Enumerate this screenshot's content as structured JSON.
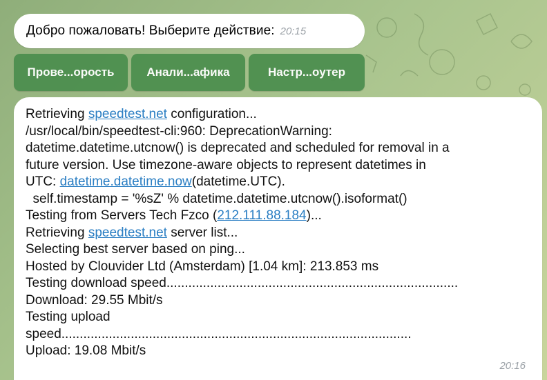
{
  "chat": {
    "welcome": {
      "text": "Добро пожаловать! Выберите действие:",
      "time": "20:15"
    },
    "keyboard": [
      {
        "label": "Прове...орость"
      },
      {
        "label": "Анали...афика"
      },
      {
        "label": "Настр...оутер"
      }
    ],
    "output": {
      "time": "20:16",
      "lines": [
        [
          {
            "t": "Retrieving "
          },
          {
            "t": "speedtest.net",
            "link": true
          },
          {
            "t": " configuration..."
          }
        ],
        [
          {
            "t": "/usr/local/bin/speedtest-cli:960: DeprecationWarning:"
          }
        ],
        [
          {
            "t": "datetime.datetime.utcnow() is deprecated and scheduled for removal in a"
          }
        ],
        [
          {
            "t": "future version. Use timezone-aware objects to represent datetimes in"
          }
        ],
        [
          {
            "t": "UTC: "
          },
          {
            "t": "datetime.datetime.now",
            "link": true
          },
          {
            "t": "(datetime.UTC)."
          }
        ],
        [
          {
            "t": "  self.timestamp = '%sZ' % datetime.datetime.utcnow().isoformat()"
          }
        ],
        [
          {
            "t": "Testing from Servers Tech Fzco ("
          },
          {
            "t": "212.111.88.184",
            "link": true
          },
          {
            "t": ")..."
          }
        ],
        [
          {
            "t": "Retrieving "
          },
          {
            "t": "speedtest.net",
            "link": true
          },
          {
            "t": " server list..."
          }
        ],
        [
          {
            "t": "Selecting best server based on ping..."
          }
        ],
        [
          {
            "t": "Hosted by Clouvider Ltd (Amsterdam) [1.04 km]: 213.853 ms"
          }
        ],
        [
          {
            "t": "Testing download speed................................................................................"
          }
        ],
        [
          {
            "t": "Download: 29.55 Mbit/s"
          }
        ],
        [
          {
            "t": "Testing upload"
          }
        ],
        [
          {
            "t": "speed................................................................................................"
          }
        ],
        [
          {
            "t": "Upload: 19.08 Mbit/s"
          }
        ]
      ]
    }
  }
}
